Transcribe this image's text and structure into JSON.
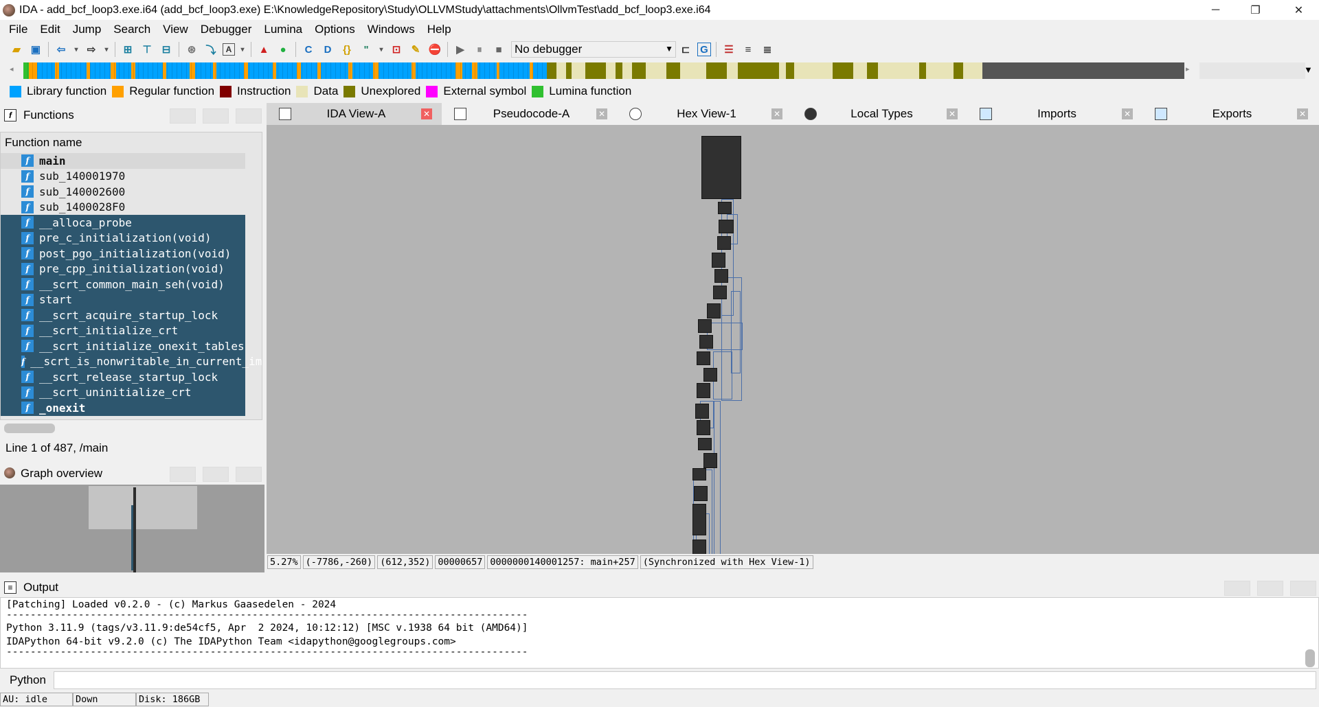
{
  "window": {
    "title": "IDA - add_bcf_loop3.exe.i64 (add_bcf_loop3.exe) E:\\KnowledgeRepository\\Study\\OLLVMStudy\\attachments\\OllvmTest\\add_bcf_loop3.exe.i64",
    "controls": [
      "─",
      "❐",
      "✕"
    ]
  },
  "menu": [
    "File",
    "Edit",
    "Jump",
    "Search",
    "View",
    "Debugger",
    "Lumina",
    "Options",
    "Windows",
    "Help"
  ],
  "toolbar": {
    "debugger_select": "No debugger"
  },
  "legend": [
    {
      "label": "Library function",
      "color": "#00a2ff"
    },
    {
      "label": "Regular function",
      "color": "#ffa000"
    },
    {
      "label": "Instruction",
      "color": "#800000"
    },
    {
      "label": "Data",
      "color": "#e8e4b8"
    },
    {
      "label": "Unexplored",
      "color": "#7a7a00"
    },
    {
      "label": "External symbol",
      "color": "#ff00ff"
    },
    {
      "label": "Lumina function",
      "color": "#30c030"
    }
  ],
  "functions_pane": {
    "title": "Functions",
    "column_header": "Function name",
    "icon_glyph": "f",
    "items": [
      "main",
      "sub_140001970",
      "sub_140002600",
      "sub_1400028F0",
      "__alloca_probe",
      "pre_c_initialization(void)",
      "post_pgo_initialization(void)",
      "pre_cpp_initialization(void)",
      "__scrt_common_main_seh(void)",
      "start",
      "__scrt_acquire_startup_lock",
      "__scrt_initialize_crt",
      "__scrt_initialize_onexit_tables",
      "__scrt_is_nonwritable_in_current_image",
      "__scrt_release_startup_lock",
      "__scrt_uninitialize_crt",
      "_onexit"
    ],
    "status": "Line 1 of 487, /main"
  },
  "overview_pane": {
    "title": "Graph overview"
  },
  "tabs": [
    {
      "label": "IDA View-A"
    },
    {
      "label": "Pseudocode-A"
    },
    {
      "label": "Hex View-1"
    },
    {
      "label": "Local Types"
    },
    {
      "label": "Imports"
    },
    {
      "label": "Exports"
    }
  ],
  "graph_status": [
    "5.27%",
    "(-7786,-260)",
    "(612,352)",
    "00000657",
    "0000000140001257: main+257",
    "(Synchronized with Hex View-1)"
  ],
  "output_pane": {
    "title": "Output",
    "lines": [
      "[Patching] Loaded v0.2.0 - (c) Markus Gaasedelen - 2024",
      "---------------------------------------------------------------------------------------",
      "Python 3.11.9 (tags/v3.11.9:de54cf5, Apr  2 2024, 10:12:12) [MSC v.1938 64 bit (AMD64)]",
      "IDAPython 64-bit v9.2.0 (c) The IDAPython Team <idapython@googlegroups.com>",
      "---------------------------------------------------------------------------------------"
    ]
  },
  "python_bar": {
    "label": "Python"
  },
  "statusbar": [
    "AU:  idle",
    "Down",
    "Disk: 186GB"
  ]
}
